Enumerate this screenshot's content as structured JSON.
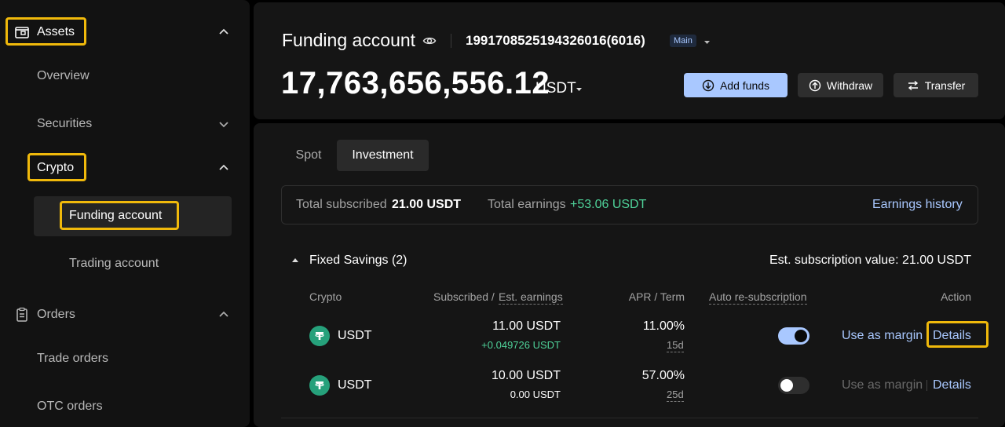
{
  "sidebar": {
    "assets": "Assets",
    "overview": "Overview",
    "securities": "Securities",
    "crypto": "Crypto",
    "funding_account": "Funding account",
    "trading_account": "Trading account",
    "orders": "Orders",
    "trade_orders": "Trade orders",
    "otc_orders": "OTC orders"
  },
  "header": {
    "title": "Funding account",
    "account_id": "19917085251943260​16(6016)",
    "account_tag": "Main",
    "balance": "17,763,656,556.12",
    "currency": "USDT",
    "buttons": {
      "add_funds": "Add funds",
      "withdraw": "Withdraw",
      "transfer": "Transfer"
    }
  },
  "tabs": {
    "spot": "Spot",
    "investment": "Investment"
  },
  "summary": {
    "total_subscribed_label": "Total subscribed",
    "total_subscribed_value": "21.00 USDT",
    "total_earnings_label": "Total earnings",
    "total_earnings_value": "+53.06 USDT",
    "earnings_history": "Earnings history"
  },
  "section": {
    "title": "Fixed Savings (2)",
    "est_value": "Est. subscription value: 21.00 USDT",
    "columns": {
      "crypto": "Crypto",
      "subscribed": "Subscribed /",
      "est_earnings": "Est. earnings",
      "apr_term": "APR / Term",
      "auto": "Auto re-subscription",
      "action": "Action"
    },
    "rows": [
      {
        "coin": "USDT",
        "subscribed": "11.00 USDT",
        "earnings": "+0.049726 USDT",
        "apr": "11.00%",
        "term": "15d",
        "auto_on": true,
        "margin": "Use as margin",
        "details": "Details"
      },
      {
        "coin": "USDT",
        "subscribed": "10.00 USDT",
        "earnings": "0.00 USDT",
        "apr": "57.00%",
        "term": "25d",
        "auto_on": false,
        "margin": "Use as margin",
        "details": "Details"
      }
    ]
  },
  "colors": {
    "accent": "#a9c8ff",
    "highlight": "#f0b90b",
    "positive": "#4fd39a",
    "tether": "#26a17b"
  }
}
